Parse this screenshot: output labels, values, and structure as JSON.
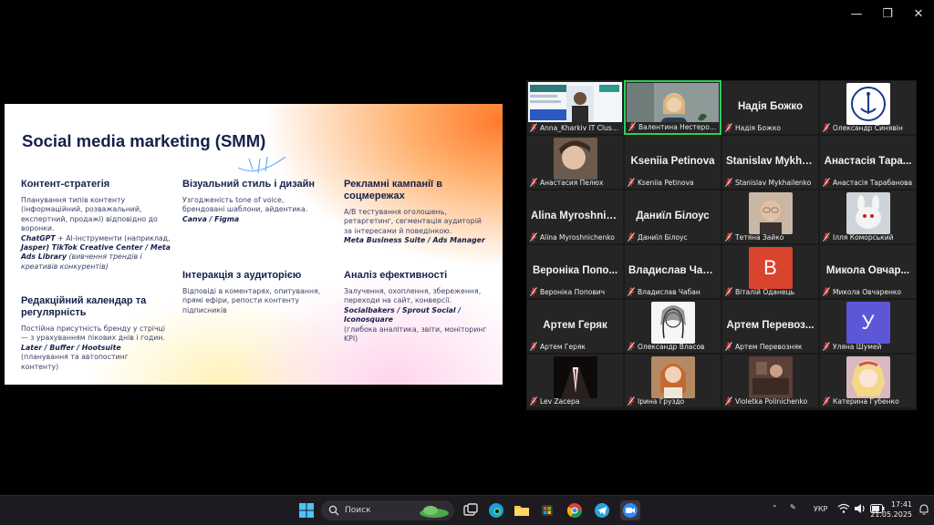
{
  "slide": {
    "title": "Social media marketing (SMM)",
    "sections": {
      "content": {
        "heading": "Контент-стратегія",
        "text": "Планування типів контенту (інформаційний, розважальний, експертний, продажі) відповідно до воронки.",
        "tools_em": "ChatGPT",
        "tools_text": " + AI-інструменти (наприклад,",
        "tools_em2": "Jasper) TikTok Creative Center / Meta Ads Library",
        "tools_it": " (вивчення трендів і креативів конкурентів)"
      },
      "calendar": {
        "heading": "Редакційний календар та регулярність",
        "text": "Постійна присутність бренду у стрічці — з урахуванням пікових днів і годин.",
        "tools_em": "Later / Buffer / Hootsuite",
        "tools_text": "(планування та автопостинг контенту)"
      },
      "visual": {
        "heading": "Візуальний стиль і дизайн",
        "text": "Узгодженість tone of voice, брендовані шаблони, айдентика.",
        "tools_em": "Canva / Figma"
      },
      "interaction": {
        "heading": "Інтеракція з аудиторією",
        "text": "Відповіді в коментарях, опитування, прямі ефіри, репости контенту підписників"
      },
      "ads": {
        "heading": "Рекламні кампанії в соцмережах",
        "text": "A/B тестування оголошень, ретаргетинг, сегментація аудиторій за інтересами й поведінкою.",
        "tools_em": "Meta Business Suite / Ads Manager"
      },
      "analytics": {
        "heading": "Аналіз ефективності",
        "text": "Залучення, охоплення, збереження, переходи на сайт, конверсії.",
        "tools_em": "Socialbakers / Sprout Social / Iconosquare",
        "tools_text": "(глибока аналітика, звіти, моніторинг KPI)"
      }
    }
  },
  "participants": [
    {
      "label": "Anna_Kharkiv IT Cluster",
      "video": "slide",
      "bg": "#dfe8f0"
    },
    {
      "label": "Валентина Нестерова",
      "video": "woman-blonde",
      "bg": "#7d8a88",
      "active": true
    },
    {
      "label": "Надія Божко",
      "title": "Надія Божко"
    },
    {
      "label": "Олександр Синявін",
      "video": "logo",
      "bg": "#2a3140"
    },
    {
      "label": "Анастасия Пелюх",
      "video": "face",
      "bg": "#6b5a4e"
    },
    {
      "label": "Kseniia Petinova",
      "title": "Kseniia Petinova"
    },
    {
      "label": "Stanislav Mykhailenko",
      "title": "Stanislav Mykha..."
    },
    {
      "label": "Анастасія Тарабанова",
      "title": "Анастасія Тара..."
    },
    {
      "label": "Alina Myroshnichenko",
      "title": "Alina Myroshnic..."
    },
    {
      "label": "Даниїл Білоус",
      "title": "Даниїл Білоус"
    },
    {
      "label": "Тетяна Зайко",
      "video": "woman-glasses",
      "bg": "#c9b7a5"
    },
    {
      "label": "Ілля Коморський",
      "video": "cartoon",
      "bg": "#cfd3da"
    },
    {
      "label": "Вероніка Попович",
      "title": "Вероніка Попо..."
    },
    {
      "label": "Владислав Чабан",
      "title": "Владислав Чаб..."
    },
    {
      "label": "Віталій Оданець",
      "avatar_letter": "B",
      "bg": "#d9442f"
    },
    {
      "label": "Микола Овчаренко",
      "title": "Микола Овчар..."
    },
    {
      "label": "Артем Геряк",
      "title": "Артем Геряк"
    },
    {
      "label": "Олександр Власов",
      "video": "sketch",
      "bg": "#e8e8e8"
    },
    {
      "label": "Артем Перевозняк",
      "title": "Артем Перевоз..."
    },
    {
      "label": "Уляна Шумей",
      "avatar_letter": "У",
      "bg": "#5b57d6"
    },
    {
      "label": "Lev Zacepa",
      "video": "suit",
      "bg": "#1a1212"
    },
    {
      "label": "Ірина Груздо",
      "video": "woman-red",
      "bg": "#b48a64"
    },
    {
      "label": "Violetka Polinichenko",
      "video": "room",
      "bg": "#5a4036"
    },
    {
      "label": "Катерина Губенко",
      "video": "anime",
      "bg": "#d9b8c0"
    }
  ],
  "taskbar": {
    "search_placeholder": "Поиск",
    "lang": "УКР",
    "time": "17:41",
    "date": "21.05.2025"
  }
}
